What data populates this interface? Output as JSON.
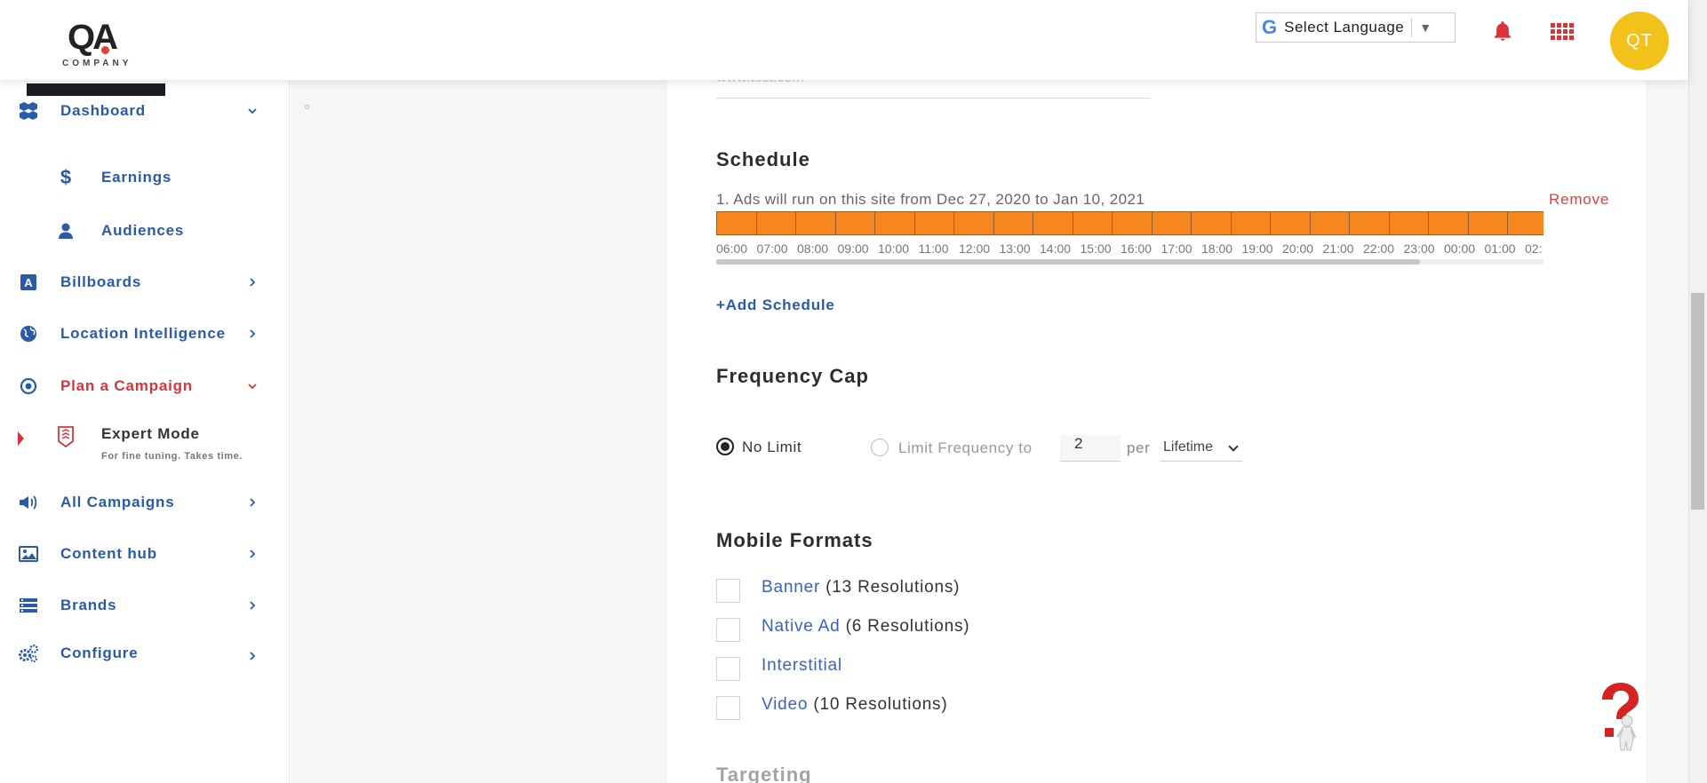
{
  "header": {
    "logo_text": "QA",
    "logo_subtitle": "COMPANY",
    "language": {
      "label": "Select Language"
    },
    "user": {
      "initials": "QT"
    },
    "colors": {
      "accent": "#d9343a",
      "avatar": "#f2c11a",
      "brand": "#2a5aa8"
    }
  },
  "sidebar": {
    "items": [
      {
        "label": "Dashboard",
        "icon": "dashboard-cubes-icon"
      },
      {
        "label": "Earnings",
        "icon": "dollar-icon"
      },
      {
        "label": "Audiences",
        "icon": "person-icon"
      },
      {
        "label": "Billboards",
        "icon": "billboard-a-icon"
      },
      {
        "label": "Location Intelligence",
        "icon": "globe-icon"
      },
      {
        "label": "Plan a Campaign",
        "icon": "target-icon"
      },
      {
        "label": "Expert Mode",
        "sublabel": "For fine tuning. Takes time.",
        "icon": "badge-icon"
      },
      {
        "label": "All Campaigns",
        "icon": "megaphone-icon"
      },
      {
        "label": "Content hub",
        "icon": "image-icon"
      },
      {
        "label": "Brands",
        "icon": "list-icon"
      },
      {
        "label": "Configure",
        "icon": "gears-icon"
      }
    ]
  },
  "form": {
    "url_value": "www.test.com",
    "schedule": {
      "title": "Schedule",
      "entry_text": "1. Ads will run on this site from Dec 27, 2020 to Jan 10, 2021",
      "remove_label": "Remove",
      "hours": [
        "06:00",
        "07:00",
        "08:00",
        "09:00",
        "10:00",
        "11:00",
        "12:00",
        "13:00",
        "14:00",
        "15:00",
        "16:00",
        "17:00",
        "18:00",
        "19:00",
        "20:00",
        "21:00",
        "22:00",
        "23:00",
        "00:00",
        "01:00",
        "02:"
      ],
      "add_label": "+Add Schedule"
    },
    "frequency": {
      "title": "Frequency Cap",
      "no_limit_label": "No Limit",
      "limit_label": "Limit Frequency to",
      "limit_value": "2",
      "per_label": "per",
      "period": "Lifetime"
    },
    "mobile_formats": {
      "title": "Mobile Formats",
      "items": [
        {
          "name": "Banner",
          "resolutions": " (13 Resolutions)"
        },
        {
          "name": "Native Ad",
          "resolutions": " (6 Resolutions)"
        },
        {
          "name": "Interstitial",
          "resolutions": ""
        },
        {
          "name": "Video",
          "resolutions": " (10 Resolutions)"
        }
      ]
    },
    "targeting": {
      "title": "Targeting"
    }
  }
}
